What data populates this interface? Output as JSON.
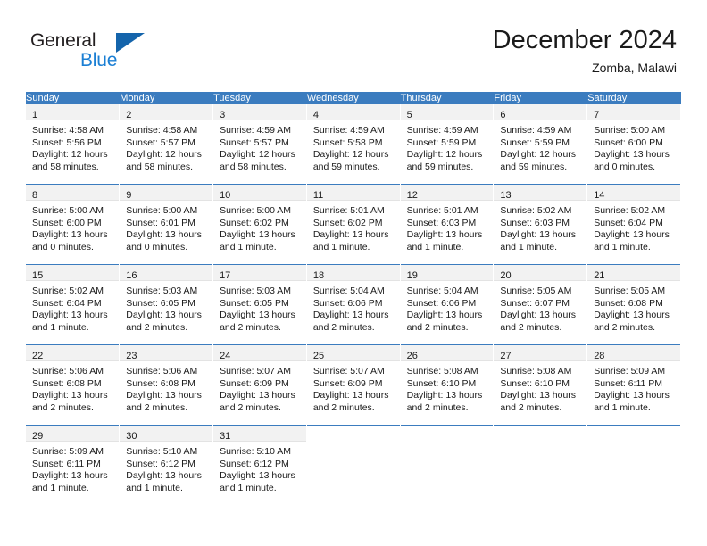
{
  "logo": {
    "primary_text": "General",
    "secondary_text": "Blue",
    "primary_color": "#231f20",
    "secondary_color": "#1b7fd4",
    "triangle_color": "#1464ab"
  },
  "header": {
    "title": "December 2024",
    "subtitle": "Zomba, Malawi"
  },
  "theme": {
    "header_bg": "#3b7cbf",
    "header_text": "#ffffff",
    "daynum_bg": "#f2f2f2",
    "cell_border": "#3b7cbf",
    "text": "#1a1a1a"
  },
  "calendar": {
    "weekday_headers": [
      "Sunday",
      "Monday",
      "Tuesday",
      "Wednesday",
      "Thursday",
      "Friday",
      "Saturday"
    ],
    "weeks": [
      [
        {
          "day": "1",
          "lines": [
            "Sunrise: 4:58 AM",
            "Sunset: 5:56 PM",
            "Daylight: 12 hours",
            "and 58 minutes."
          ]
        },
        {
          "day": "2",
          "lines": [
            "Sunrise: 4:58 AM",
            "Sunset: 5:57 PM",
            "Daylight: 12 hours",
            "and 58 minutes."
          ]
        },
        {
          "day": "3",
          "lines": [
            "Sunrise: 4:59 AM",
            "Sunset: 5:57 PM",
            "Daylight: 12 hours",
            "and 58 minutes."
          ]
        },
        {
          "day": "4",
          "lines": [
            "Sunrise: 4:59 AM",
            "Sunset: 5:58 PM",
            "Daylight: 12 hours",
            "and 59 minutes."
          ]
        },
        {
          "day": "5",
          "lines": [
            "Sunrise: 4:59 AM",
            "Sunset: 5:59 PM",
            "Daylight: 12 hours",
            "and 59 minutes."
          ]
        },
        {
          "day": "6",
          "lines": [
            "Sunrise: 4:59 AM",
            "Sunset: 5:59 PM",
            "Daylight: 12 hours",
            "and 59 minutes."
          ]
        },
        {
          "day": "7",
          "lines": [
            "Sunrise: 5:00 AM",
            "Sunset: 6:00 PM",
            "Daylight: 13 hours",
            "and 0 minutes."
          ]
        }
      ],
      [
        {
          "day": "8",
          "lines": [
            "Sunrise: 5:00 AM",
            "Sunset: 6:00 PM",
            "Daylight: 13 hours",
            "and 0 minutes."
          ]
        },
        {
          "day": "9",
          "lines": [
            "Sunrise: 5:00 AM",
            "Sunset: 6:01 PM",
            "Daylight: 13 hours",
            "and 0 minutes."
          ]
        },
        {
          "day": "10",
          "lines": [
            "Sunrise: 5:00 AM",
            "Sunset: 6:02 PM",
            "Daylight: 13 hours",
            "and 1 minute."
          ]
        },
        {
          "day": "11",
          "lines": [
            "Sunrise: 5:01 AM",
            "Sunset: 6:02 PM",
            "Daylight: 13 hours",
            "and 1 minute."
          ]
        },
        {
          "day": "12",
          "lines": [
            "Sunrise: 5:01 AM",
            "Sunset: 6:03 PM",
            "Daylight: 13 hours",
            "and 1 minute."
          ]
        },
        {
          "day": "13",
          "lines": [
            "Sunrise: 5:02 AM",
            "Sunset: 6:03 PM",
            "Daylight: 13 hours",
            "and 1 minute."
          ]
        },
        {
          "day": "14",
          "lines": [
            "Sunrise: 5:02 AM",
            "Sunset: 6:04 PM",
            "Daylight: 13 hours",
            "and 1 minute."
          ]
        }
      ],
      [
        {
          "day": "15",
          "lines": [
            "Sunrise: 5:02 AM",
            "Sunset: 6:04 PM",
            "Daylight: 13 hours",
            "and 1 minute."
          ]
        },
        {
          "day": "16",
          "lines": [
            "Sunrise: 5:03 AM",
            "Sunset: 6:05 PM",
            "Daylight: 13 hours",
            "and 2 minutes."
          ]
        },
        {
          "day": "17",
          "lines": [
            "Sunrise: 5:03 AM",
            "Sunset: 6:05 PM",
            "Daylight: 13 hours",
            "and 2 minutes."
          ]
        },
        {
          "day": "18",
          "lines": [
            "Sunrise: 5:04 AM",
            "Sunset: 6:06 PM",
            "Daylight: 13 hours",
            "and 2 minutes."
          ]
        },
        {
          "day": "19",
          "lines": [
            "Sunrise: 5:04 AM",
            "Sunset: 6:06 PM",
            "Daylight: 13 hours",
            "and 2 minutes."
          ]
        },
        {
          "day": "20",
          "lines": [
            "Sunrise: 5:05 AM",
            "Sunset: 6:07 PM",
            "Daylight: 13 hours",
            "and 2 minutes."
          ]
        },
        {
          "day": "21",
          "lines": [
            "Sunrise: 5:05 AM",
            "Sunset: 6:08 PM",
            "Daylight: 13 hours",
            "and 2 minutes."
          ]
        }
      ],
      [
        {
          "day": "22",
          "lines": [
            "Sunrise: 5:06 AM",
            "Sunset: 6:08 PM",
            "Daylight: 13 hours",
            "and 2 minutes."
          ]
        },
        {
          "day": "23",
          "lines": [
            "Sunrise: 5:06 AM",
            "Sunset: 6:08 PM",
            "Daylight: 13 hours",
            "and 2 minutes."
          ]
        },
        {
          "day": "24",
          "lines": [
            "Sunrise: 5:07 AM",
            "Sunset: 6:09 PM",
            "Daylight: 13 hours",
            "and 2 minutes."
          ]
        },
        {
          "day": "25",
          "lines": [
            "Sunrise: 5:07 AM",
            "Sunset: 6:09 PM",
            "Daylight: 13 hours",
            "and 2 minutes."
          ]
        },
        {
          "day": "26",
          "lines": [
            "Sunrise: 5:08 AM",
            "Sunset: 6:10 PM",
            "Daylight: 13 hours",
            "and 2 minutes."
          ]
        },
        {
          "day": "27",
          "lines": [
            "Sunrise: 5:08 AM",
            "Sunset: 6:10 PM",
            "Daylight: 13 hours",
            "and 2 minutes."
          ]
        },
        {
          "day": "28",
          "lines": [
            "Sunrise: 5:09 AM",
            "Sunset: 6:11 PM",
            "Daylight: 13 hours",
            "and 1 minute."
          ]
        }
      ],
      [
        {
          "day": "29",
          "lines": [
            "Sunrise: 5:09 AM",
            "Sunset: 6:11 PM",
            "Daylight: 13 hours",
            "and 1 minute."
          ]
        },
        {
          "day": "30",
          "lines": [
            "Sunrise: 5:10 AM",
            "Sunset: 6:12 PM",
            "Daylight: 13 hours",
            "and 1 minute."
          ]
        },
        {
          "day": "31",
          "lines": [
            "Sunrise: 5:10 AM",
            "Sunset: 6:12 PM",
            "Daylight: 13 hours",
            "and 1 minute."
          ]
        },
        {
          "day": "",
          "lines": []
        },
        {
          "day": "",
          "lines": []
        },
        {
          "day": "",
          "lines": []
        },
        {
          "day": "",
          "lines": []
        }
      ]
    ]
  }
}
